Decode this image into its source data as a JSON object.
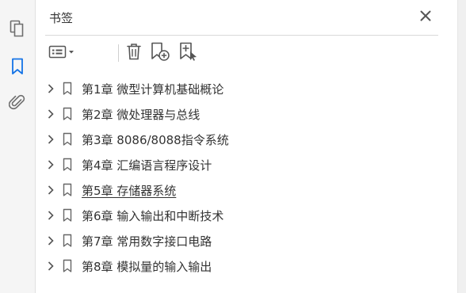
{
  "panel": {
    "title": "书签"
  },
  "rail": {
    "icons": [
      "pages-icon",
      "bookmarks-icon",
      "attachments-icon"
    ],
    "accent": "#1473e6"
  },
  "toolbar": {
    "icons": [
      "options-menu-icon",
      "delete-icon",
      "new-bookmark-icon",
      "new-bookmark-from-structure-icon"
    ]
  },
  "bookmarks": [
    {
      "label": "第1章  微型计算机基础概论",
      "underlined": false
    },
    {
      "label": "第2章  微处理器与总线",
      "underlined": false
    },
    {
      "label": "第3章  8086/8088指令系统",
      "underlined": false
    },
    {
      "label": "第4章  汇编语言程序设计",
      "underlined": false
    },
    {
      "label": "第5章  存储器系统",
      "underlined": true
    },
    {
      "label": "第6章  输入输出和中断技术",
      "underlined": false
    },
    {
      "label": "第7章  常用数字接口电路",
      "underlined": false
    },
    {
      "label": "第8章  模拟量的输入输出",
      "underlined": false
    }
  ]
}
